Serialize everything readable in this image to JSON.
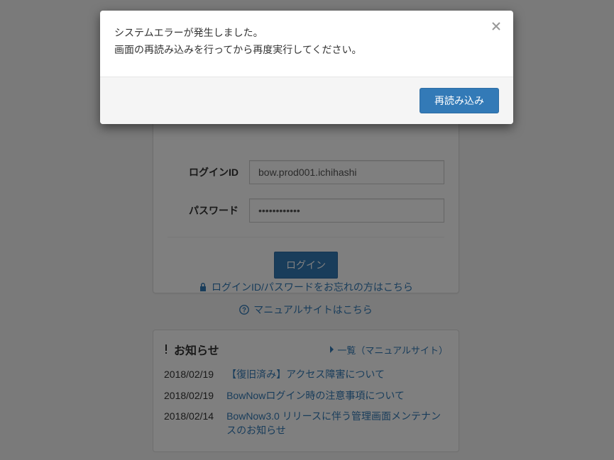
{
  "modal": {
    "line1": "システムエラーが発生しました。",
    "line2": "画面の再読み込みを行ってから再度実行してください。",
    "close_label": "×",
    "reload_label": "再読み込み"
  },
  "login": {
    "id_label": "ログインID",
    "id_value": "bow.prod001.ichihashi",
    "password_label": "パスワード",
    "password_value": "••••••••••••",
    "login_button": "ログイン"
  },
  "links": {
    "forgot": "ログインID/パスワードをお忘れの方はこちら",
    "manual": "マニュアルサイトはこちら"
  },
  "news": {
    "heading": "お知らせ",
    "all_label": "一覧（マニュアルサイト）",
    "items": [
      {
        "date": "2018/02/19",
        "title": "【復旧済み】アクセス障害について"
      },
      {
        "date": "2018/02/19",
        "title": "BowNowログイン時の注意事項について"
      },
      {
        "date": "2018/02/14",
        "title": "BowNow3.0 リリースに伴う管理画面メンテナンスのお知らせ"
      }
    ]
  },
  "colors": {
    "primary": "#337ab7",
    "overlay": "rgba(0,0,0,0.5)"
  }
}
